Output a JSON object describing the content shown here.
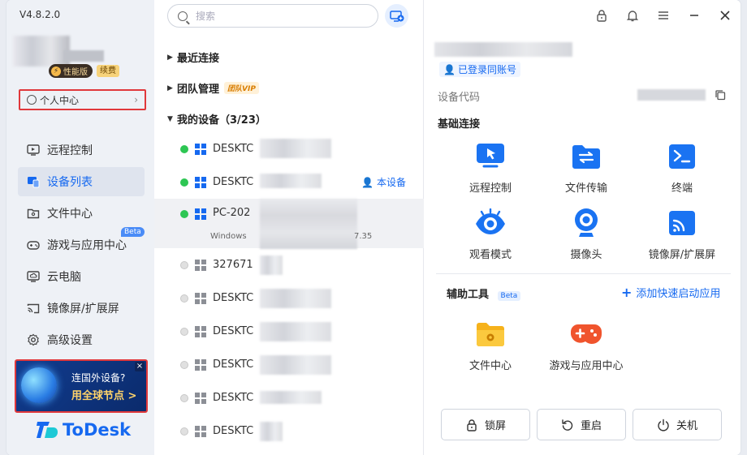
{
  "app": {
    "version": "V4.8.2.0",
    "logo_text": "ToDesk"
  },
  "user": {
    "badge_perf": "性能版",
    "badge_renew": "续费",
    "personal_center": "个人中心"
  },
  "sidebar": {
    "items": [
      {
        "label": "远程控制",
        "icon": "monitor-icon"
      },
      {
        "label": "设备列表",
        "icon": "device-list-icon",
        "active": true
      },
      {
        "label": "文件中心",
        "icon": "folder-icon"
      },
      {
        "label": "游戏与应用中心",
        "icon": "gamepad-icon",
        "tag": "Beta"
      },
      {
        "label": "云电脑",
        "icon": "cloud-pc-icon"
      },
      {
        "label": "镜像屏/扩展屏",
        "icon": "cast-icon"
      },
      {
        "label": "高级设置",
        "icon": "gear-icon"
      }
    ]
  },
  "promo": {
    "line1": "连国外设备?",
    "line2": "用全球节点 >",
    "close": "×"
  },
  "search": {
    "placeholder": "搜索"
  },
  "groups": {
    "recent": "最近连接",
    "team": "团队管理",
    "team_tag": "团队VIP",
    "mine": "我的设备（3/23）"
  },
  "devices": [
    {
      "name": "DESKTC",
      "online": true
    },
    {
      "name": "DESKTC",
      "online": true,
      "tag": "本设备"
    },
    {
      "name": "PC-202",
      "online": true,
      "os": "Windows",
      "sub_tail": "7.35"
    },
    {
      "name": "327671",
      "online": false
    },
    {
      "name": "DESKTC",
      "online": false
    },
    {
      "name": "DESKTC",
      "online": false
    },
    {
      "name": "DESKTC",
      "online": false
    },
    {
      "name": "DESKTC",
      "online": false
    },
    {
      "name": "DESKTC",
      "online": false
    }
  ],
  "detail": {
    "logged_in": "已登录同账号",
    "code_label": "设备代码",
    "basic_title": "基础连接",
    "basic": [
      {
        "label": "远程控制",
        "icon": "remote-control-icon"
      },
      {
        "label": "文件传输",
        "icon": "file-transfer-icon"
      },
      {
        "label": "终端",
        "icon": "terminal-icon"
      },
      {
        "label": "观看模式",
        "icon": "eye-icon"
      },
      {
        "label": "摄像头",
        "icon": "camera-icon"
      },
      {
        "label": "镜像屏/扩展屏",
        "icon": "cast-icon"
      }
    ],
    "tools_title": "辅助工具",
    "tools_tag": "Beta",
    "add_quick": "添加快速启动应用",
    "tools": [
      {
        "label": "文件中心",
        "icon": "folder-gear-icon"
      },
      {
        "label": "游戏与应用中心",
        "icon": "gamepad-icon"
      }
    ],
    "power": [
      {
        "label": "锁屏",
        "icon": "lock-icon"
      },
      {
        "label": "重启",
        "icon": "restart-icon"
      },
      {
        "label": "关机",
        "icon": "power-icon"
      }
    ]
  },
  "colors": {
    "accent": "#1669f0",
    "online": "#2dc653",
    "highlight_border": "#e0383b"
  }
}
